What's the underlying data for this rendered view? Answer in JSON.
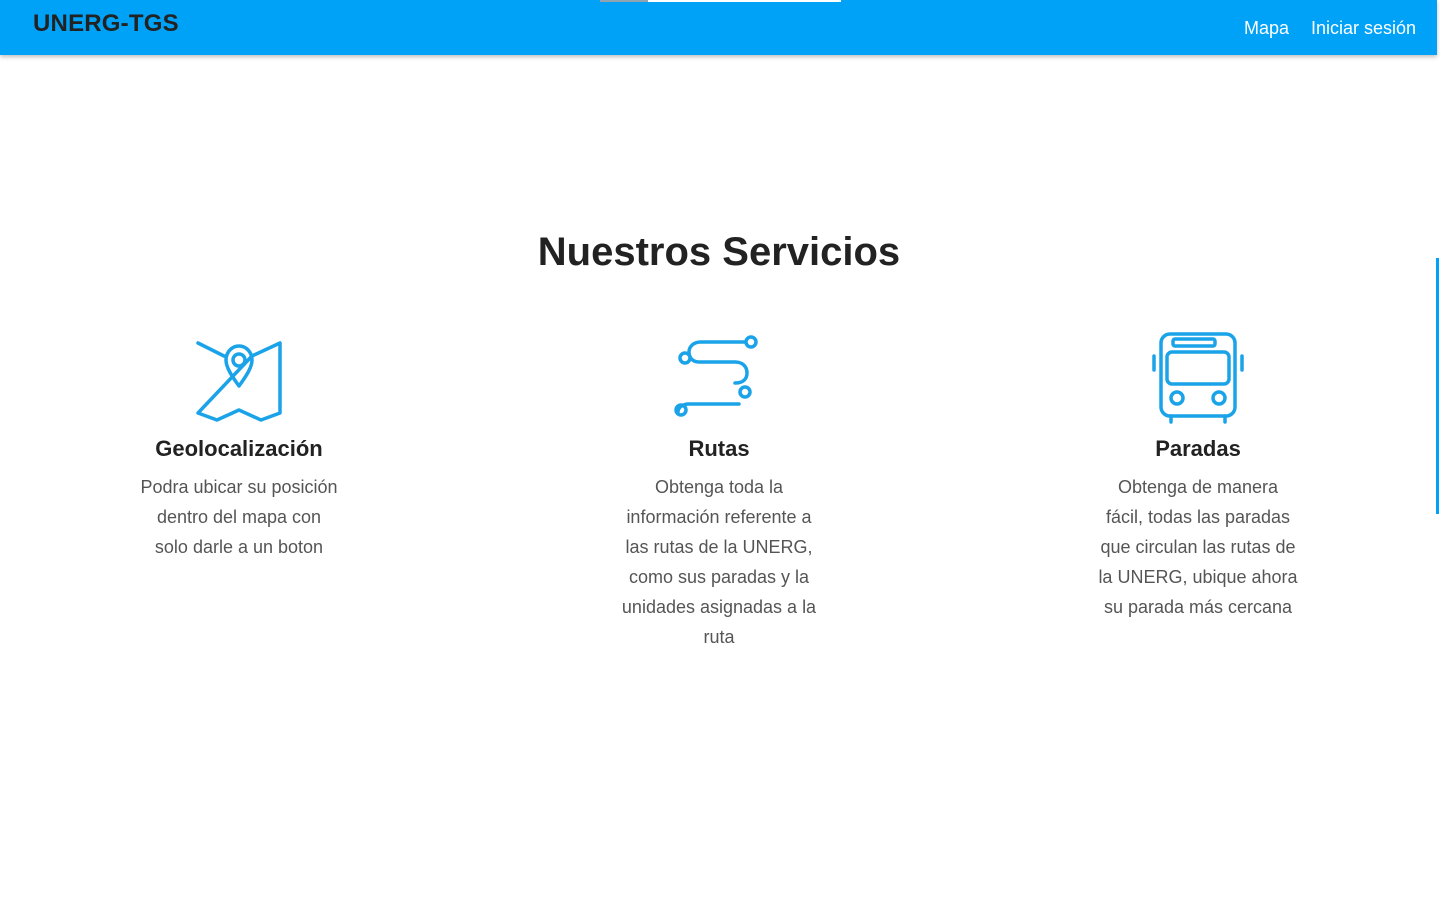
{
  "navbar": {
    "brand": "UNERG-TGS",
    "links": [
      {
        "label": "Mapa"
      },
      {
        "label": "Iniciar sesión"
      }
    ],
    "background_color": "#00a2f8"
  },
  "main": {
    "title": "Nuestros Servicios",
    "services": [
      {
        "icon": "map-pin-icon",
        "title": "Geolocalización",
        "description": "Podra ubicar su posición dentro del mapa con solo darle a un boton"
      },
      {
        "icon": "route-icon",
        "title": "Rutas",
        "description": "Obtenga toda la información referente a las rutas de la UNERG, como sus paradas y la unidades asignadas a la ruta"
      },
      {
        "icon": "bus-icon",
        "title": "Paradas",
        "description": "Obtenga de manera fácil, todas las paradas que circulan las rutas de la UNERG, ubique ahora su parada más cercana"
      }
    ],
    "accent_color": "#1aa3e8"
  }
}
